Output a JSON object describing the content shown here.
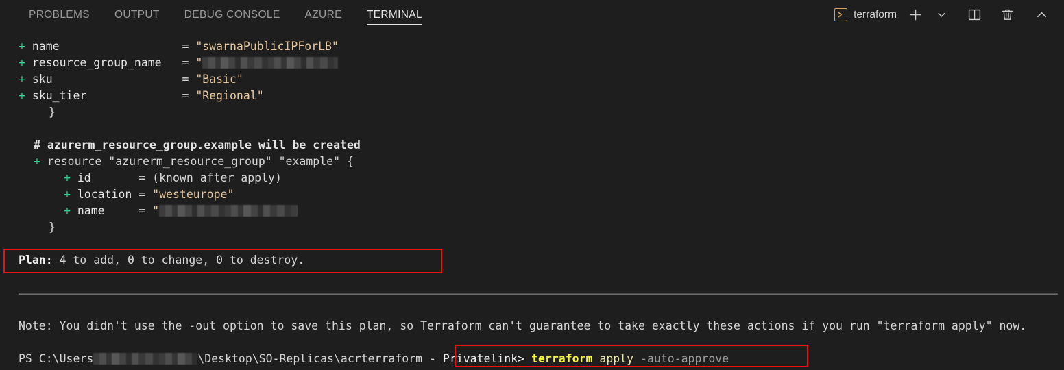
{
  "panel": {
    "tabs": [
      {
        "label": "PROBLEMS",
        "active": false
      },
      {
        "label": "OUTPUT",
        "active": false
      },
      {
        "label": "DEBUG CONSOLE",
        "active": false
      },
      {
        "label": "AZURE",
        "active": false
      },
      {
        "label": "TERMINAL",
        "active": true
      }
    ],
    "actions": {
      "terminal_icon": "terminal-prompt-icon",
      "terminal_name": "terraform",
      "new_terminal_icon": "plus-icon",
      "new_terminal_dropdown_icon": "chevron-down-icon",
      "split_terminal_icon": "split-panel-icon",
      "kill_terminal_icon": "trash-icon",
      "collapse_panel_icon": "chevron-up-icon"
    }
  },
  "terminal": {
    "accent_color": "#d7a156",
    "background_color": "#1e1e1e",
    "plus_color": "#23d18b",
    "string_color": "#e8c9a0",
    "annotation_color": "#ee1111",
    "lines": {
      "l1_plus": "+",
      "l1_key": "name",
      "l1_eq": "=",
      "l1_val": "\"swarnaPublicIPForLB\"",
      "l2_plus": "+",
      "l2_key": "resource_group_name",
      "l2_eq": "=",
      "l2_val_prefix": "\"",
      "l2_val_redacted": "[redacted]",
      "l3_plus": "+",
      "l3_key": "sku",
      "l3_eq": "=",
      "l3_val": "\"Basic\"",
      "l4_plus": "+",
      "l4_key": "sku_tier",
      "l4_eq": "=",
      "l4_val": "\"Regional\"",
      "l5_close": "}",
      "l6_comment": "# azurerm_resource_group.example will be created",
      "l7_plus": "+",
      "l7_text": "resource \"azurerm_resource_group\" \"example\" {",
      "l8_plus": "+",
      "l8_key": "id",
      "l8_eq": "=",
      "l8_val": "(known after apply)",
      "l9_plus": "+",
      "l9_key": "location",
      "l9_eq": "=",
      "l9_val": "\"westeurope\"",
      "l10_plus": "+",
      "l10_key": "name",
      "l10_eq": "=",
      "l10_val_prefix": "\"",
      "l10_val_redacted": "[redacted]",
      "l11_close": "}",
      "plan_label": "Plan:",
      "plan_summary": " 4 to add, 0 to change, 0 to destroy.",
      "note_text": "Note: You didn't use the -out option to save this plan, so Terraform can't guarantee to take exactly these actions if you run \"terraform apply\" now.",
      "prompt_ps": "PS C:\\Users",
      "prompt_user_redacted": "[redacted]",
      "prompt_path": "\\Desktop\\SO-Replicas\\acrterraform - ",
      "prompt_suffix": "Privatelink>",
      "cmd_binary": "terraform",
      "cmd_action": "apply",
      "cmd_flag": "-auto-approve"
    }
  }
}
